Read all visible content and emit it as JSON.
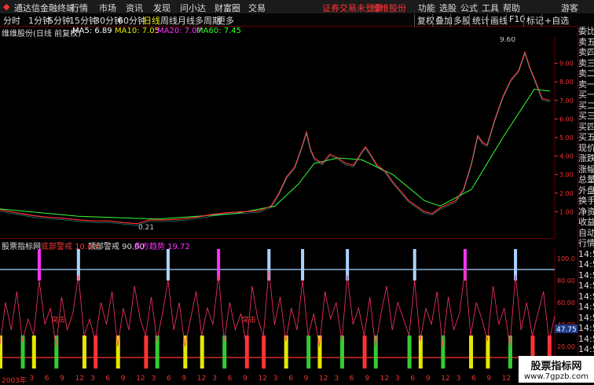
{
  "app": {
    "title": "通达信金融终端",
    "menus": [
      "行情",
      "市场",
      "资讯",
      "发现",
      "问小达",
      "财富圈",
      "交易"
    ],
    "notice": "证券交易未登录",
    "stock_link": "维维股份",
    "right_menus": [
      "功能",
      "选股",
      "公式",
      "工具",
      "帮助"
    ],
    "user": "游客"
  },
  "toolbar": {
    "timeframes": [
      "分时",
      "1分钟",
      "5分钟",
      "15分钟",
      "30分钟",
      "60分钟",
      "日线",
      "周线",
      "月线",
      "多周期",
      "更多"
    ],
    "active": "日线",
    "right_buttons": [
      "复权",
      "叠加",
      "多股",
      "统计",
      "画线",
      "F10",
      "标记",
      "+自选"
    ]
  },
  "chart_header": {
    "name": "维维股份(日线 前复权)",
    "ma5": "MA5: 6.89",
    "ma10": "MA10: 7.05",
    "ma20": "MA20: 7.07",
    "ma60": "MA60: 7.45"
  },
  "colors": {
    "ma5": "#ffffff",
    "ma10": "#e6e600",
    "ma20": "#ff33ff",
    "ma60": "#33ff33",
    "up": "#ff3333",
    "down": "#33ffff",
    "accent": "#e33"
  },
  "chart_data": {
    "type": "line",
    "title": "维维股份(日线 前复权)",
    "ylim": [
      0,
      10
    ],
    "y_ticks": [
      "1.00",
      "2.00",
      "3.00",
      "4.00",
      "5.00",
      "6.00",
      "7.00",
      "8.00",
      "9.00"
    ],
    "annotations": {
      "high": "9.60",
      "low": "0.21"
    },
    "price": [
      [
        0,
        1.1
      ],
      [
        20,
        0.95
      ],
      [
        40,
        0.8
      ],
      [
        60,
        0.7
      ],
      [
        80,
        0.65
      ],
      [
        100,
        0.55
      ],
      [
        120,
        0.5
      ],
      [
        140,
        0.5
      ],
      [
        160,
        0.4
      ],
      [
        175,
        0.35
      ],
      [
        190,
        0.55
      ],
      [
        210,
        0.55
      ],
      [
        230,
        0.6
      ],
      [
        250,
        0.7
      ],
      [
        270,
        0.85
      ],
      [
        290,
        0.95
      ],
      [
        310,
        1.0
      ],
      [
        330,
        1.05
      ],
      [
        345,
        1.3
      ],
      [
        355,
        2.0
      ],
      [
        365,
        2.9
      ],
      [
        375,
        3.4
      ],
      [
        385,
        4.6
      ],
      [
        390,
        5.3
      ],
      [
        395,
        4.4
      ],
      [
        400,
        3.9
      ],
      [
        410,
        3.6
      ],
      [
        420,
        4.1
      ],
      [
        430,
        3.9
      ],
      [
        440,
        3.6
      ],
      [
        450,
        3.5
      ],
      [
        460,
        4.2
      ],
      [
        465,
        4.5
      ],
      [
        470,
        4.2
      ],
      [
        480,
        3.5
      ],
      [
        490,
        3.2
      ],
      [
        500,
        2.6
      ],
      [
        510,
        2.1
      ],
      [
        520,
        1.6
      ],
      [
        530,
        1.3
      ],
      [
        540,
        1.0
      ],
      [
        550,
        0.9
      ],
      [
        560,
        1.2
      ],
      [
        570,
        1.4
      ],
      [
        580,
        1.6
      ],
      [
        590,
        2.2
      ],
      [
        600,
        3.6
      ],
      [
        608,
        5.1
      ],
      [
        615,
        4.7
      ],
      [
        620,
        4.6
      ],
      [
        630,
        6.0
      ],
      [
        640,
        7.2
      ],
      [
        650,
        8.1
      ],
      [
        660,
        8.6
      ],
      [
        668,
        9.6
      ],
      [
        675,
        8.7
      ],
      [
        680,
        8.2
      ],
      [
        690,
        7.1
      ],
      [
        700,
        7.0
      ]
    ],
    "ma60": [
      [
        0,
        1.15
      ],
      [
        100,
        0.75
      ],
      [
        200,
        0.6
      ],
      [
        300,
        0.9
      ],
      [
        350,
        1.3
      ],
      [
        380,
        2.5
      ],
      [
        400,
        3.6
      ],
      [
        430,
        3.9
      ],
      [
        460,
        3.8
      ],
      [
        500,
        3.0
      ],
      [
        540,
        1.6
      ],
      [
        560,
        1.3
      ],
      [
        600,
        2.2
      ],
      [
        640,
        5.0
      ],
      [
        680,
        7.6
      ],
      [
        700,
        7.5
      ]
    ],
    "indicator": {
      "name": "股票指标网",
      "series_labels": [
        "底部警戒 10.00",
        "顶部警戒 90.00",
        "多方趋势 19.72"
      ],
      "y_ticks": [
        "20.00",
        "40.00",
        "60.00",
        "80.00",
        "100.0"
      ],
      "current": "47.75",
      "signal_label": "突击",
      "values": [
        22,
        60,
        35,
        70,
        25,
        45,
        30,
        80,
        40,
        55,
        20,
        65,
        35,
        50,
        85,
        30,
        45,
        25,
        60,
        40,
        70,
        20,
        55,
        35,
        75,
        45,
        30,
        65,
        25,
        50,
        80,
        35,
        60,
        20,
        45,
        70,
        30,
        55,
        40,
        85,
        25,
        60,
        35,
        50,
        20,
        75,
        45,
        30,
        90,
        40,
        65,
        25,
        55,
        35,
        80,
        30,
        50,
        20,
        70,
        45,
        60,
        25,
        85,
        40,
        55,
        30,
        65,
        20,
        50,
        75,
        35,
        60,
        45,
        30,
        80,
        25,
        55,
        40,
        70,
        20,
        65,
        35,
        50,
        90,
        30,
        60,
        45,
        25,
        75,
        40,
        55,
        20,
        85,
        35,
        60,
        30,
        50,
        70,
        25,
        47.75
      ]
    }
  },
  "right_panel": {
    "items": [
      "委比",
      "卖五",
      "卖四",
      "卖三",
      "卖二",
      "卖一",
      "买一",
      "买二",
      "买三",
      "买四",
      "买五",
      "现价",
      "涨跌",
      "涨幅",
      "总量",
      "外盘",
      "换手",
      "净资",
      "收益",
      "自动",
      "行情",
      "14:56",
      "14:56",
      "14:56",
      "14:56",
      "14:56",
      "14:56",
      "14:56",
      "14:56",
      "14:56",
      "14:56"
    ]
  },
  "date_axis": {
    "labels": [
      "2003年",
      "3",
      "6",
      "9",
      "12",
      "3",
      "6",
      "9",
      "12",
      "3",
      "6",
      "9",
      "12",
      "3",
      "6",
      "9",
      "12",
      "3",
      "6",
      "9",
      "12",
      "3",
      "6",
      "9",
      "12",
      "3",
      "6",
      "9",
      "12",
      "3",
      "6",
      "9",
      "12",
      "3",
      "6",
      "9"
    ]
  },
  "watermark": {
    "line1": "股票指标网",
    "line2": "www.7gpzb.com"
  }
}
